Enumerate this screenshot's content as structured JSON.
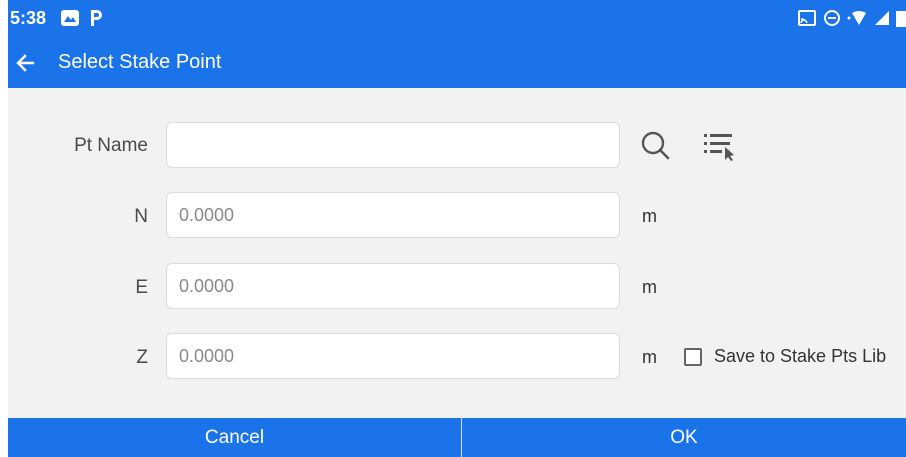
{
  "status": {
    "time": "5:38",
    "left_icons": [
      "gallery-notification-icon",
      "parking-app-icon"
    ],
    "right_icons": [
      "cast-icon",
      "do-not-disturb-icon",
      "wifi-icon",
      "signal-icon",
      "battery-icon"
    ]
  },
  "titlebar": {
    "title": "Select Stake Point",
    "back_icon": "arrow-left-icon"
  },
  "form": {
    "pt_name": {
      "label": "Pt Name",
      "value": "",
      "placeholder": ""
    },
    "n": {
      "label": "N",
      "value": "",
      "placeholder": "0.0000",
      "unit": "m"
    },
    "e": {
      "label": "E",
      "value": "",
      "placeholder": "0.0000",
      "unit": "m"
    },
    "z": {
      "label": "Z",
      "value": "",
      "placeholder": "0.0000",
      "unit": "m"
    },
    "search_icon": "search-icon",
    "list_icon": "point-list-icon",
    "save_checkbox": {
      "label": "Save to Stake Pts Lib",
      "checked": false
    }
  },
  "footer": {
    "cancel_label": "Cancel",
    "ok_label": "OK"
  },
  "colors": {
    "accent": "#1a73e8",
    "background": "#f2f2f2",
    "field_bg": "#ffffff"
  }
}
